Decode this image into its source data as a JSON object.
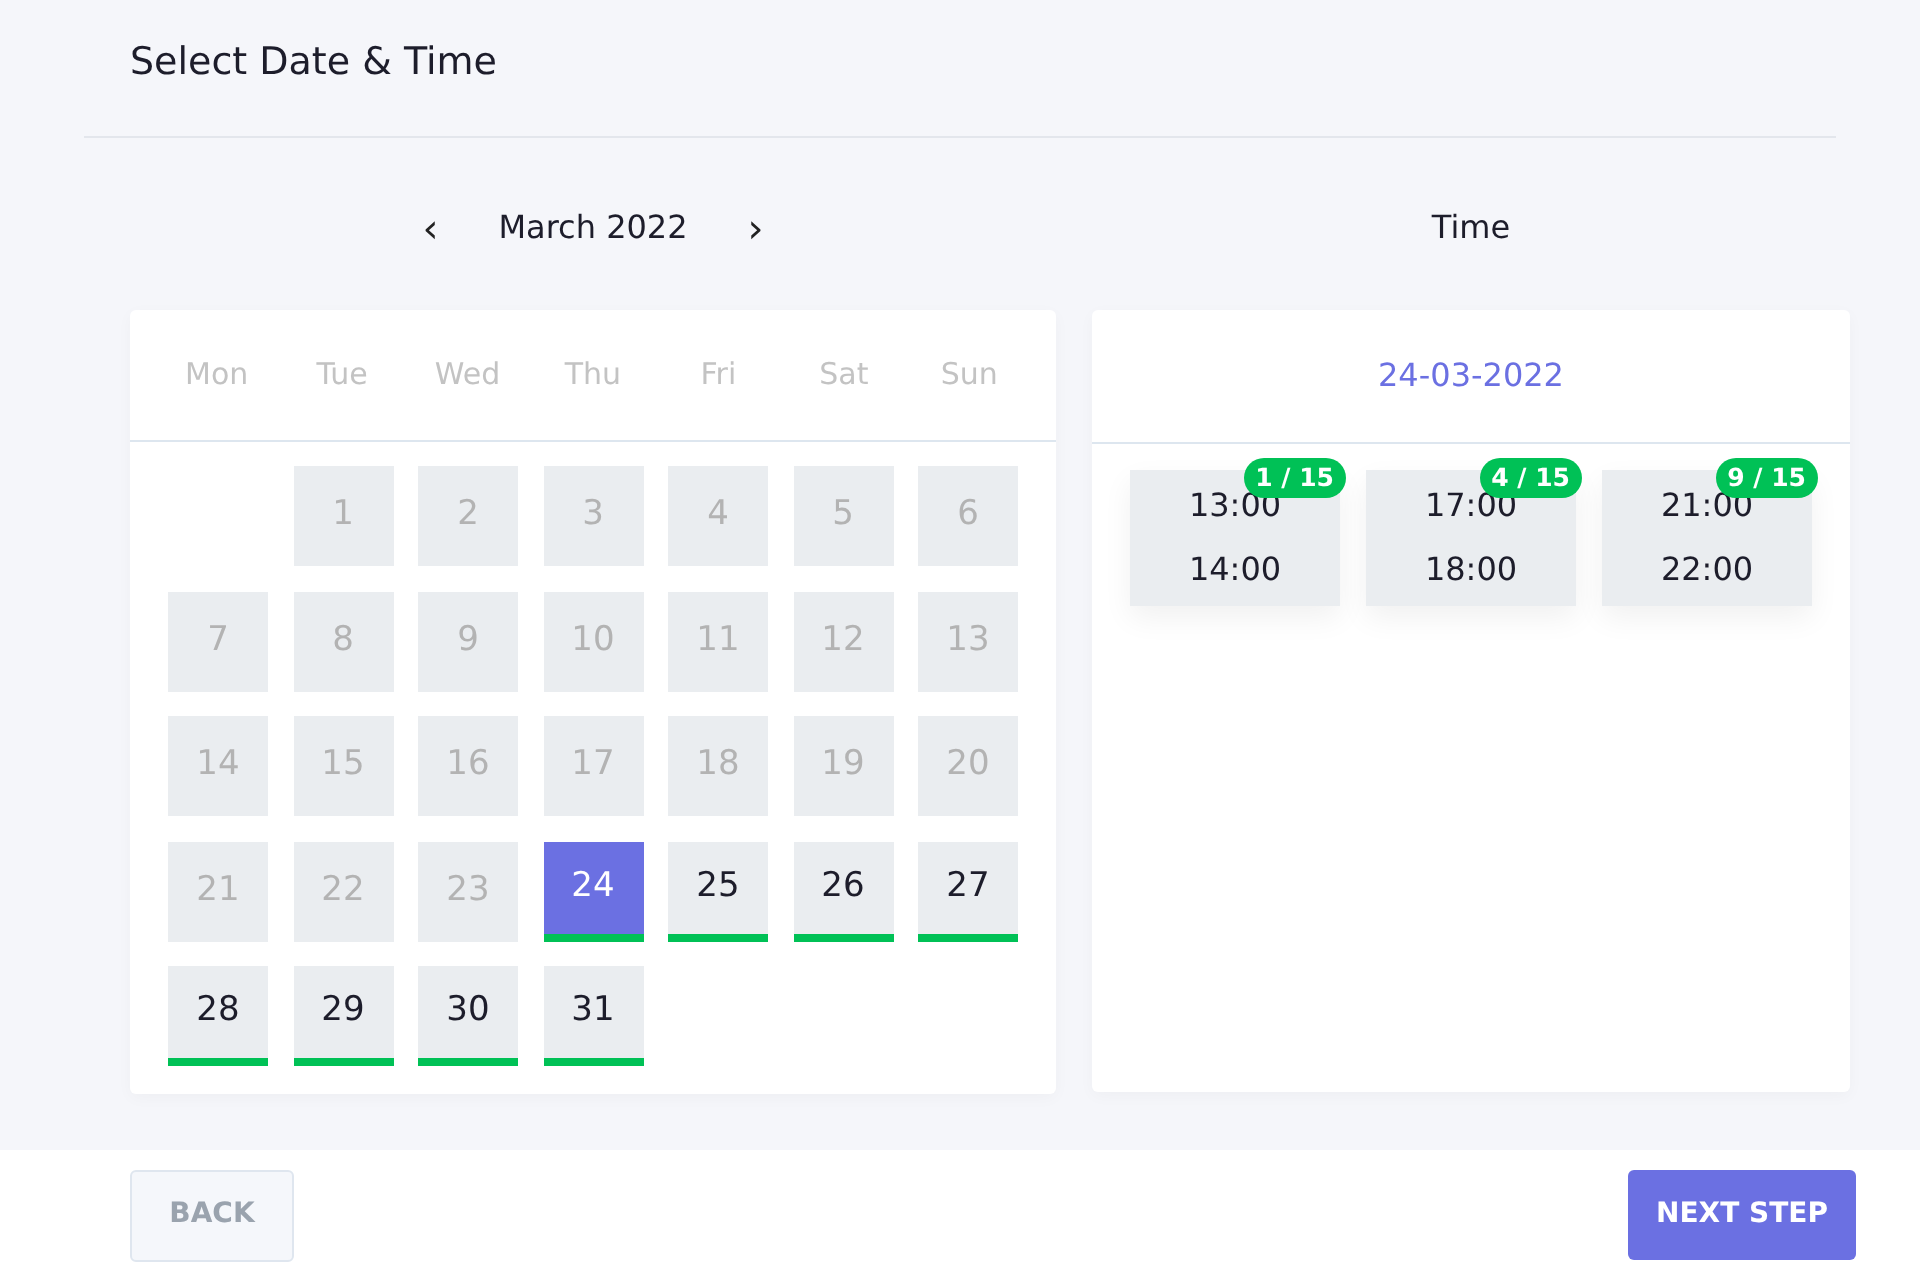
{
  "title": "Select Date & Time",
  "calendar": {
    "prev": "‹",
    "month": "March 2022",
    "next": "›",
    "weekdays": [
      "Mon",
      "Tue",
      "Wed",
      "Thu",
      "Fri",
      "Sat",
      "Sun"
    ],
    "weeks": [
      [
        {
          "day": "1",
          "available": false,
          "selected": false
        },
        {
          "day": "2",
          "available": false,
          "selected": false
        },
        {
          "day": "3",
          "available": false,
          "selected": false
        },
        {
          "day": "4",
          "available": false,
          "selected": false
        },
        {
          "day": "5",
          "available": false,
          "selected": false
        },
        {
          "day": "6",
          "available": false,
          "selected": false
        }
      ],
      [
        {
          "day": "7",
          "available": false,
          "selected": false
        },
        {
          "day": "8",
          "available": false,
          "selected": false
        },
        {
          "day": "9",
          "available": false,
          "selected": false
        },
        {
          "day": "10",
          "available": false,
          "selected": false
        },
        {
          "day": "11",
          "available": false,
          "selected": false
        },
        {
          "day": "12",
          "available": false,
          "selected": false
        },
        {
          "day": "13",
          "available": false,
          "selected": false
        }
      ],
      [
        {
          "day": "14",
          "available": false,
          "selected": false
        },
        {
          "day": "15",
          "available": false,
          "selected": false
        },
        {
          "day": "16",
          "available": false,
          "selected": false
        },
        {
          "day": "17",
          "available": false,
          "selected": false
        },
        {
          "day": "18",
          "available": false,
          "selected": false
        },
        {
          "day": "19",
          "available": false,
          "selected": false
        },
        {
          "day": "20",
          "available": false,
          "selected": false
        }
      ],
      [
        {
          "day": "21",
          "available": false,
          "selected": false
        },
        {
          "day": "22",
          "available": false,
          "selected": false
        },
        {
          "day": "23",
          "available": false,
          "selected": false
        },
        {
          "day": "24",
          "available": true,
          "selected": true
        },
        {
          "day": "25",
          "available": true,
          "selected": false
        },
        {
          "day": "26",
          "available": true,
          "selected": false
        },
        {
          "day": "27",
          "available": true,
          "selected": false
        }
      ],
      [
        {
          "day": "28",
          "available": true,
          "selected": false
        },
        {
          "day": "29",
          "available": true,
          "selected": false
        },
        {
          "day": "30",
          "available": true,
          "selected": false
        },
        {
          "day": "31",
          "available": true,
          "selected": false
        }
      ]
    ]
  },
  "time": {
    "heading": "Time",
    "date": "24-03-2022",
    "slots": [
      {
        "start": "13:00",
        "end": "14:00",
        "badge": "1 / 15"
      },
      {
        "start": "17:00",
        "end": "18:00",
        "badge": "4 / 15"
      },
      {
        "start": "21:00",
        "end": "22:00",
        "badge": "9 / 15"
      }
    ]
  },
  "buttons": {
    "back": "BACK",
    "next": "NEXT STEP"
  }
}
